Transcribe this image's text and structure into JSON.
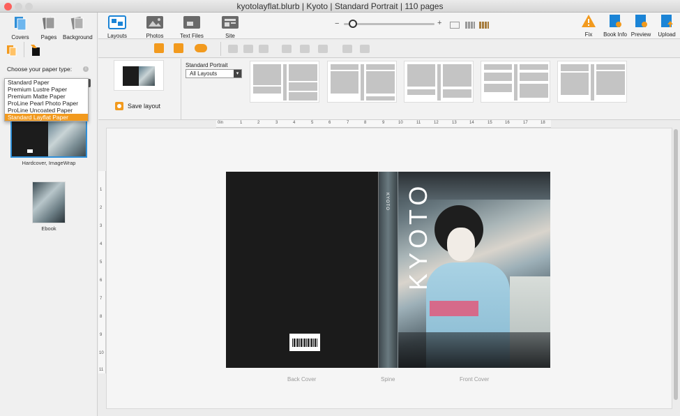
{
  "window": {
    "title": "kyotolayflat.blurb | Kyoto | Standard Portrait | 110 pages"
  },
  "sidebar": {
    "tabs": [
      {
        "label": "Covers"
      },
      {
        "label": "Pages"
      },
      {
        "label": "Background"
      }
    ],
    "paper_prompt": "Choose your paper type:",
    "paper_options": [
      "Standard Paper",
      "Premium Lustre Paper",
      "Premium Matte Paper",
      "ProLine Pearl Photo Paper",
      "ProLine Uncoated Paper",
      "Standard Layflat Paper"
    ],
    "paper_selected": "Standard Layflat Paper",
    "covers": [
      {
        "label": "Hardcover, ImageWrap"
      },
      {
        "label": "Ebook"
      }
    ]
  },
  "toolbar": {
    "left_buttons": [
      {
        "label": "Layouts"
      },
      {
        "label": "Photos"
      },
      {
        "label": "Text Files"
      },
      {
        "label": "Site Import"
      }
    ],
    "right_buttons": [
      {
        "label": "Fix"
      },
      {
        "label": "Book Info"
      },
      {
        "label": "Preview"
      },
      {
        "label": "Upload"
      }
    ],
    "zoom_minus": "−",
    "zoom_plus": "+"
  },
  "layouts": {
    "save_label": "Save layout",
    "book_size": "Standard Portrait",
    "filter_value": "All Layouts"
  },
  "ruler": {
    "unit": "0in",
    "h_ticks": [
      "1",
      "2",
      "3",
      "4",
      "5",
      "6",
      "7",
      "8",
      "9",
      "10",
      "11",
      "12",
      "13",
      "14",
      "15",
      "16",
      "17",
      "18"
    ],
    "v_ticks": [
      "1",
      "2",
      "3",
      "4",
      "5",
      "6",
      "7",
      "8",
      "9",
      "10",
      "11"
    ]
  },
  "spread": {
    "back_label": "Back Cover",
    "spine_label": "Spine",
    "front_label": "Front Cover",
    "cover_title": "KYOTO",
    "spine_text": "KYOTO"
  },
  "colors": {
    "accent": "#f29a1e",
    "selection_blue": "#2f8fd8",
    "icon_blue": "#1b84d6"
  }
}
